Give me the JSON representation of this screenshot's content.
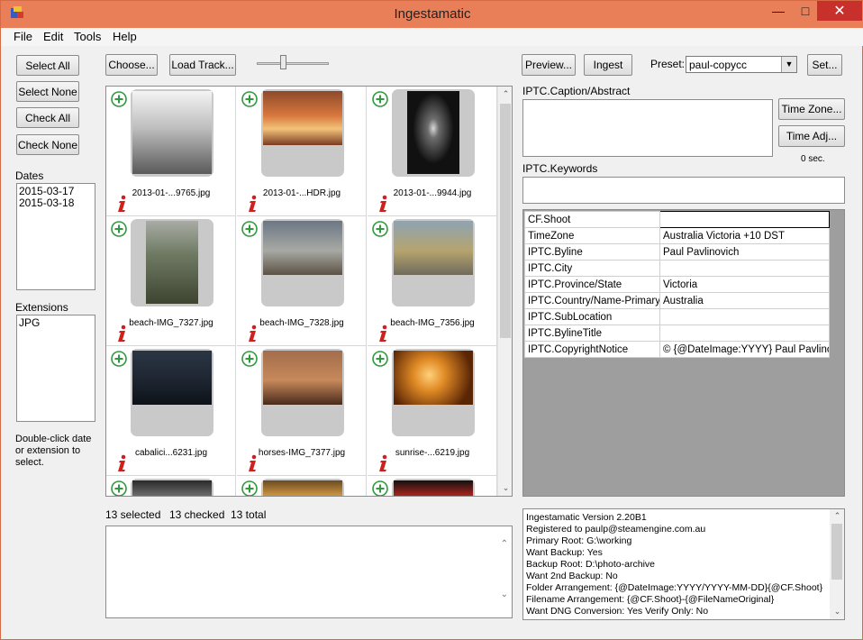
{
  "app": {
    "title": "Ingestamatic"
  },
  "menu": [
    "File",
    "Edit",
    "Tools",
    "Help"
  ],
  "left": {
    "select_all": "Select All",
    "select_none": "Select None",
    "check_all": "Check All",
    "check_none": "Check None",
    "dates_label": "Dates",
    "dates": [
      "2015-03-17",
      "2015-03-18"
    ],
    "extensions_label": "Extensions",
    "extensions": [
      "JPG"
    ],
    "hint": [
      "Double-click date",
      "or extension to",
      "select."
    ]
  },
  "toolbar": {
    "choose": "Choose...",
    "load_track": "Load Track...",
    "preview": "Preview...",
    "ingest": "Ingest",
    "preset_label": "Preset:",
    "preset_value": "paul-copycc",
    "set": "Set..."
  },
  "thumbs": [
    {
      "name": "2013-01-...9765.jpg"
    },
    {
      "name": "2013-01-...HDR.jpg"
    },
    {
      "name": "2013-01-...9944.jpg"
    },
    {
      "name": "beach-IMG_7327.jpg"
    },
    {
      "name": "beach-IMG_7328.jpg"
    },
    {
      "name": "beach-IMG_7356.jpg"
    },
    {
      "name": "cabalici...6231.jpg"
    },
    {
      "name": "horses-IMG_7377.jpg"
    },
    {
      "name": "sunrise-...6219.jpg"
    },
    {
      "name": ""
    },
    {
      "name": ""
    },
    {
      "name": ""
    }
  ],
  "status": {
    "selected": "13 selected",
    "checked": "13 checked",
    "total": "13 total"
  },
  "right": {
    "caption_label": "IPTC.Caption/Abstract",
    "time_zone": "Time Zone...",
    "time_adj": "Time Adj...",
    "time_offset": "0 sec.",
    "keywords_label": "IPTC.Keywords",
    "fields": [
      {
        "key": "CF.Shoot",
        "value": ""
      },
      {
        "key": "TimeZone",
        "value": "Australia Victoria +10 DST"
      },
      {
        "key": "IPTC.Byline",
        "value": "Paul Pavlinovich"
      },
      {
        "key": "IPTC.City",
        "value": ""
      },
      {
        "key": "IPTC.Province/State",
        "value": "Victoria"
      },
      {
        "key": "IPTC.Country/Name-Primary...",
        "value": "Australia"
      },
      {
        "key": "IPTC.SubLocation",
        "value": ""
      },
      {
        "key": "IPTC.BylineTitle",
        "value": ""
      },
      {
        "key": "IPTC.CopyrightNotice",
        "value": "© {@DateImage:YYYY} Paul Pavlinovi"
      }
    ],
    "log": [
      "Ingestamatic Version 2.20B1",
      "Registered to paulp@steamengine.com.au",
      "Primary Root: G:\\working",
      "Want Backup: Yes",
      "Backup Root: D:\\photo-archive",
      "Want 2nd Backup: No",
      "Folder Arrangement: {@DateImage:YYYY/YYYY-MM-DD}{@CF.Shoot}",
      "Filename Arrangement: {@CF.Shoot}-{@FileNameOriginal}",
      "Want DNG Conversion: Yes     Verify Only: No"
    ]
  },
  "colors": {
    "titlebar": "#e97f58",
    "close": "#c7302b",
    "plus": "#2e9a3a",
    "info": "#d0201e"
  }
}
